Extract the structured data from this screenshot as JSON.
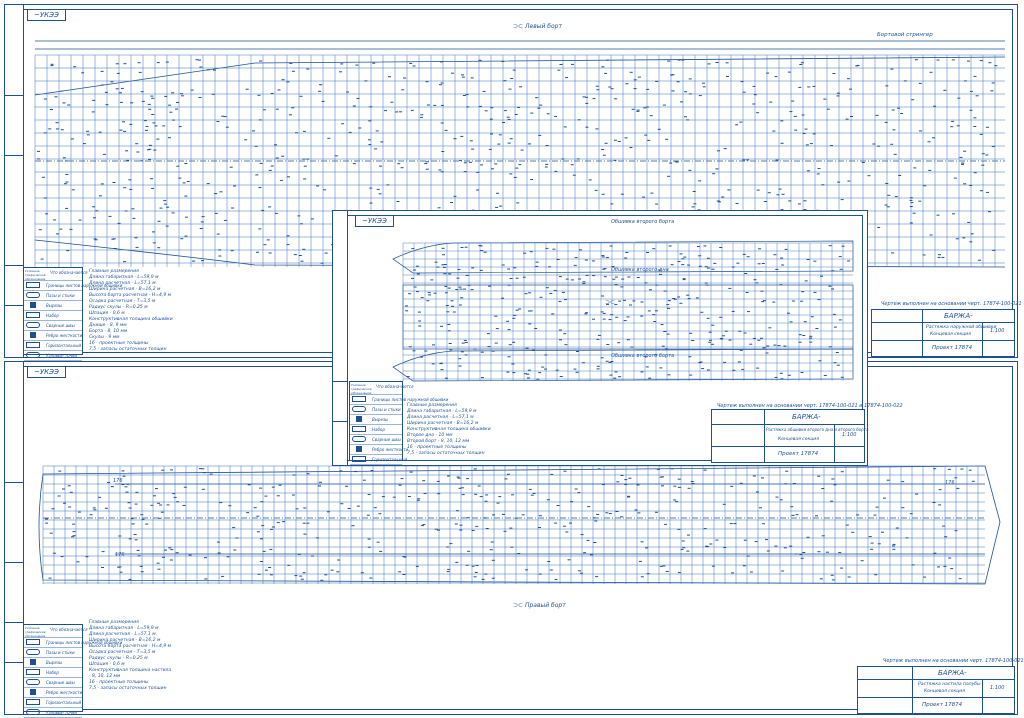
{
  "sheet_top": {
    "tag": "~УКЭЭ",
    "view_label": "Левый борт",
    "stringer_label": "Бортовой стрингер",
    "note": "Чертеж выполнен на основании черт. 17874-100-021",
    "title": {
      "name": "БАРЖА-",
      "drawing": "Растяжка наружной обшивки",
      "section": "Концевая секция",
      "project": "Проект 17874",
      "scale": "1:100"
    }
  },
  "sheet_mid": {
    "tag": "~УКЭЭ",
    "view_top": "Обшивка второго борта",
    "view_mid": "Обшивка второго дна",
    "view_bottom": "Обшивка второго борта",
    "note": "Чертеж выполнен на основании черт. 17874-100-021 и 17874-100-022",
    "title": {
      "name": "БАРЖА-",
      "drawing": "Растяжка обшивки второго дна и второго борта",
      "section": "Концевая секция",
      "project": "Проект 17874",
      "scale": "1:100"
    }
  },
  "sheet_bottom": {
    "tag": "~УКЭЭ",
    "view_label": "Правый борт",
    "note": "Чертеж выполнен на основании черт. 17874-100-021",
    "title": {
      "name": "БАРЖА-",
      "drawing": "Растяжка настила палубы",
      "section": "Концевая секция",
      "project": "Проект 17874",
      "scale": "1:100"
    }
  },
  "legend": {
    "head_symbol": "Условное графическое обозначение",
    "head_name": "Что обозначается",
    "items": [
      "Границы листов наружной обшивки",
      "Пазы и стыки",
      "Вырезы",
      "Набор",
      "Сварные швы",
      "Ребро жесткости",
      "Горизонтальный",
      "Узловые точки",
      "Перемычки",
      "Шпангоуты"
    ]
  },
  "notes_top": [
    "Главные размерения",
    "Длина габаритная - L=59,9 м",
    "Длина расчетная - L=57,1 м",
    "Ширина расчетная - B=16,2 м",
    "Высота борта расчетная - Н=4,9 м",
    "Осадка расчетная - Т=3,5 м",
    "Радиус скулы - R=0,25 м",
    "Шпация - 0,6 м",
    "Конструктивная толщина обшивки",
    "Днище - 8, 9 мм",
    "Борта - 8, 10 мм",
    "Скулы - 9 мм",
    "16 - проектные толщины",
    "7,5 - запасы остаточных толщин"
  ],
  "notes_mid": [
    "Главные размерения",
    "Длина габаритная - L=59,9 м",
    "Длина расчетная - L=57,1 м",
    "Ширина расчетная - B=16,2 м",
    "Конструктивная толщина обшивки",
    "Второе дно - 10 мм",
    "Второй борт - 8, 10, 12 мм",
    "16 - проектные толщины",
    "7,5 - запасы остаточных толщин"
  ],
  "notes_bottom": [
    "Главные размерения",
    "Длина габаритная - L=59,9 м",
    "Длина расчетная - L=57,1 м",
    "Ширина расчетная - B=16,2 м",
    "Высота борта расчетная - Н=4,9 м",
    "Осадка расчетная - Т=3,5 м",
    "Радиус скулы - R=0,25 м",
    "Шпация - 0,6 м",
    "Конструктивная толщина настила",
    "- 8, 10, 12 мм",
    "16 - проектные толщины",
    "7,5 - запасы остаточных толщин"
  ],
  "sheet_numbers": {
    "top": "170",
    "bottom_left": "176",
    "bottom_mid": "176",
    "bottom_right": "176"
  },
  "colors": {
    "line": "#1d4f91",
    "grid": "#3b73c2",
    "light": "#9bb6d8"
  }
}
